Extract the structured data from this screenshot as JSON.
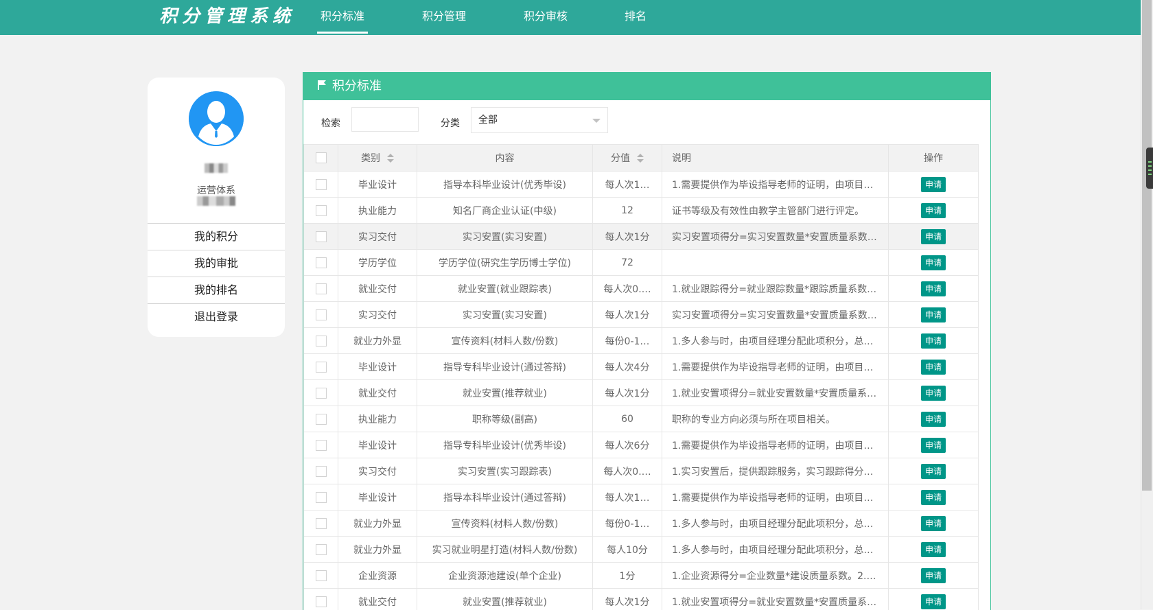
{
  "brand": "积分管理系统",
  "nav": [
    {
      "label": "积分标准"
    },
    {
      "label": "积分管理"
    },
    {
      "label": "积分审核"
    },
    {
      "label": "排名"
    }
  ],
  "profile": {
    "dept": "运营体系",
    "menu": [
      {
        "label": "我的积分"
      },
      {
        "label": "我的审批"
      },
      {
        "label": "我的排名"
      },
      {
        "label": "退出登录"
      }
    ]
  },
  "panel": {
    "title": "积分标准",
    "search_label": "检索",
    "search_value": "",
    "category_label": "分类",
    "category_selected": "全部"
  },
  "table": {
    "headers": {
      "category": "类别",
      "content": "内容",
      "score": "分值",
      "desc": "说明",
      "action": "操作"
    },
    "action_label": "申请",
    "rows": [
      {
        "category": "毕业设计",
        "content": "指导本科毕业设计(优秀毕设)",
        "score": "每人次1…",
        "desc": "1.需要提供作为毕设指导老师的证明，由项目…"
      },
      {
        "category": "执业能力",
        "content": "知名厂商企业认证(中级)",
        "score": "12",
        "desc": "证书等级及有效性由教学主管部门进行评定。"
      },
      {
        "category": "实习交付",
        "content": "实习安置(实习安置)",
        "score": "每人次1分",
        "desc": "实习安置项得分=实习安置数量*安置质量系数…"
      },
      {
        "category": "学历学位",
        "content": "学历学位(研究生学历博士学位)",
        "score": "72",
        "desc": ""
      },
      {
        "category": "就业交付",
        "content": "就业安置(就业跟踪表)",
        "score": "每人次0.…",
        "desc": "1.就业跟踪得分=就业跟踪数量*跟踪质量系数…"
      },
      {
        "category": "实习交付",
        "content": "实习安置(实习安置)",
        "score": "每人次1分",
        "desc": "实习安置项得分=实习安置数量*安置质量系数…"
      },
      {
        "category": "就业力外显",
        "content": "宣传资料(材料人数/份数)",
        "score": "每份0-1…",
        "desc": "1.多人参与时，由项目经理分配此项积分，总…"
      },
      {
        "category": "毕业设计",
        "content": "指导专科毕业设计(通过答辩)",
        "score": "每人次4分",
        "desc": "1.需要提供作为毕设指导老师的证明，由项目…"
      },
      {
        "category": "就业交付",
        "content": "就业安置(推荐就业)",
        "score": "每人次1分",
        "desc": "1.就业安置项得分=就业安置数量*安置质量系…"
      },
      {
        "category": "执业能力",
        "content": "职称等级(副高)",
        "score": "60",
        "desc": "职称的专业方向必须与所在项目相关。"
      },
      {
        "category": "毕业设计",
        "content": "指导专科毕业设计(优秀毕设)",
        "score": "每人次6分",
        "desc": "1.需要提供作为毕设指导老师的证明，由项目…"
      },
      {
        "category": "实习交付",
        "content": "实习安置(实习跟踪表)",
        "score": "每人次0.…",
        "desc": "1.实习安置后，提供跟踪服务，实习跟踪得分=…"
      },
      {
        "category": "毕业设计",
        "content": "指导本科毕业设计(通过答辩)",
        "score": "每人次1…",
        "desc": "1.需要提供作为毕设指导老师的证明，由项目…"
      },
      {
        "category": "就业力外显",
        "content": "宣传资料(材料人数/份数)",
        "score": "每份0-1…",
        "desc": "1.多人参与时，由项目经理分配此项积分，总…"
      },
      {
        "category": "就业力外显",
        "content": "实习就业明星打造(材料人数/份数)",
        "score": "每人10分",
        "desc": "1.多人参与时，由项目经理分配此项积分，总…"
      },
      {
        "category": "企业资源",
        "content": "企业资源池建设(单个企业)",
        "score": "1分",
        "desc": "1.企业资源得分=企业数量*建设质量系数。2.…"
      },
      {
        "category": "就业交付",
        "content": "就业安置(推荐就业)",
        "score": "每人次1分",
        "desc": "1.就业安置项得分=就业安置数量*安置质量系…"
      }
    ]
  },
  "colors": {
    "topbar": "#2ea89a",
    "panel_header": "#3fc199",
    "button": "#009688",
    "avatar": "#2196f3"
  }
}
